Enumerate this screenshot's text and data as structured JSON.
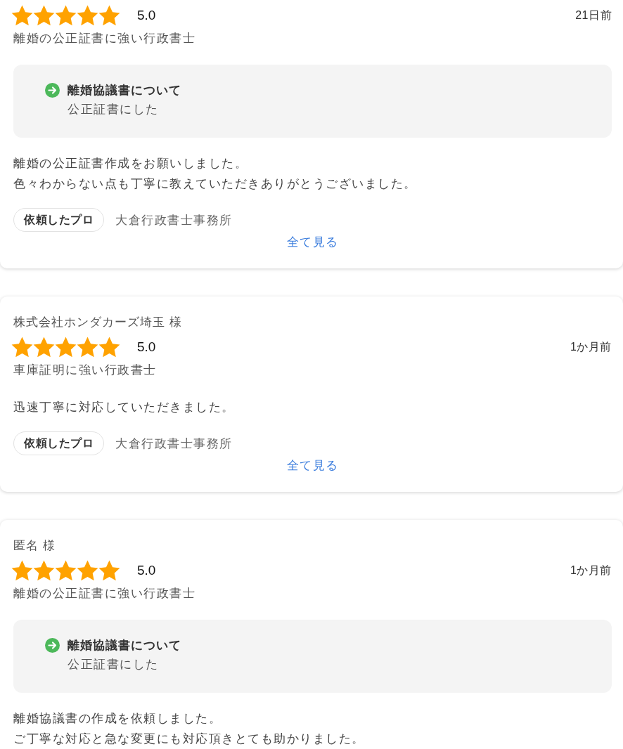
{
  "reviews": [
    {
      "stars": 5,
      "rating": "5.0",
      "date": "21日前",
      "category": "離婚の公正証書に強い行政書士",
      "highlight": {
        "title": "離婚協議書について",
        "subtitle": "公正証書にした"
      },
      "text_lines": [
        "離婚の公正証書作成をお願いしました。",
        "色々わからない点も丁寧に教えていただきありがとうございました。"
      ],
      "pro": {
        "label": "依頼したプロ",
        "name": "大倉行政書士事務所"
      },
      "more_link": "全て見る"
    },
    {
      "author": "株式会社ホンダカーズ埼玉 様",
      "stars": 5,
      "rating": "5.0",
      "date": "1か月前",
      "category": "車庫証明に強い行政書士",
      "text_lines": [
        "迅速丁寧に対応していただきました。"
      ],
      "pro": {
        "label": "依頼したプロ",
        "name": "大倉行政書士事務所"
      },
      "more_link": "全て見る"
    },
    {
      "author": "匿名 様",
      "stars": 5,
      "rating": "5.0",
      "date": "1か月前",
      "category": "離婚の公正証書に強い行政書士",
      "highlight": {
        "title": "離婚協議書について",
        "subtitle": "公正証書にした"
      },
      "text_lines": [
        "離婚協議書の作成を依頼しました。",
        "ご丁寧な対応と急な変更にも対応頂きとても助かりました。"
      ]
    }
  ]
}
